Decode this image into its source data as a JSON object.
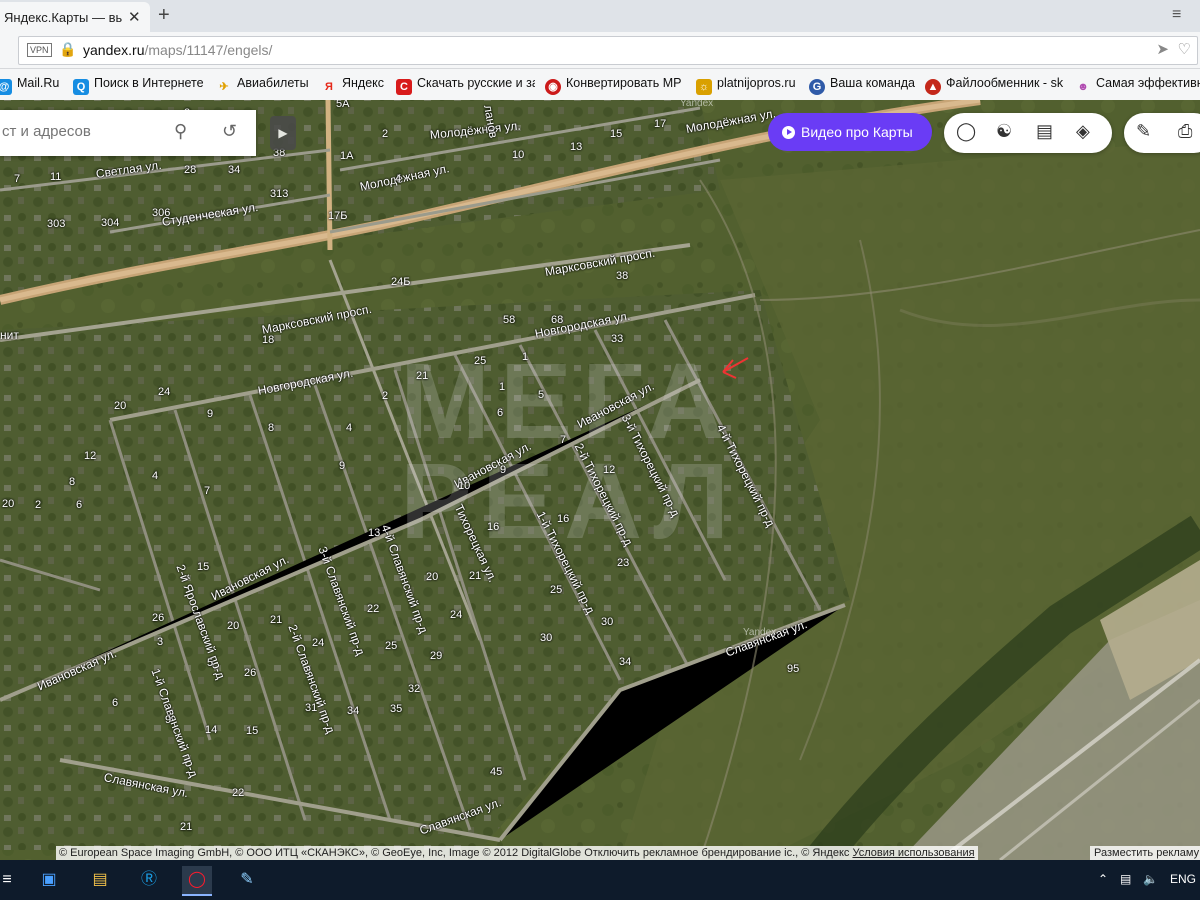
{
  "browser": {
    "tab_title": "Яндекс.Карты — выбирай",
    "close_glyph": "✕",
    "new_tab_glyph": "+",
    "menu_glyph": "≡",
    "vpn_label": "VPN",
    "url_host": "yandex.ru",
    "url_path": "/maps/11147/engels/"
  },
  "bookmarks": [
    {
      "label": "Mail.Ru",
      "icon": "mailru-icon",
      "color": "#168de2"
    },
    {
      "label": "Поиск в Интернете",
      "icon": "search-icon",
      "color": "#168de2"
    },
    {
      "label": "Авиабилеты",
      "icon": "plane-icon",
      "color": "#f2a400"
    },
    {
      "label": "Яндекс",
      "icon": "yandex-icon",
      "color": "#e5281a"
    },
    {
      "label": "Скачать русские и за",
      "icon": "download-icon",
      "color": "#d81b1b"
    },
    {
      "label": "Конвертировать МР",
      "icon": "convert-icon",
      "color": "#cc1a1a"
    },
    {
      "label": "platnijopros.ru",
      "icon": "poll-icon",
      "color": "#d9a000"
    },
    {
      "label": "Ваша команда",
      "icon": "team-icon",
      "color": "#2f5aa8"
    },
    {
      "label": "Файлообменник - sk",
      "icon": "file-share-icon",
      "color": "#c4281a"
    },
    {
      "label": "Самая эффективна",
      "icon": "effective-icon",
      "color": "#b04ab0"
    }
  ],
  "map_ui": {
    "search_placeholder": "ст и адресов",
    "video_button": "Видео про Карты",
    "copyright": "© European Space Imaging GmbH, © ООО ИТЦ «СКАНЭКС», © GeoEye, Inc, Image © 2012 DigitalGlobe",
    "ad_disable": "Отключить рекламное брендирование",
    "copyright_yandex": "ic., © Яндекс",
    "terms": "Условия использования",
    "place_ad": "Разместить рекламу",
    "yandex_mark": "Yandex",
    "watermark_line1": "МЕГА",
    "watermark_line2": "РЕАЛ"
  },
  "streets": [
    {
      "name": "Светлая ул."
    },
    {
      "name": "Студенческая ул."
    },
    {
      "name": "Молодёжная ул."
    },
    {
      "name": "Молодёжная ул."
    },
    {
      "name": "Молодёжная ул."
    },
    {
      "name": "Марксовский просп."
    },
    {
      "name": "Марксовский просп."
    },
    {
      "name": "Новгородская ул."
    },
    {
      "name": "Новгородская ул."
    },
    {
      "name": "Ивановская ул."
    },
    {
      "name": "Ивановская ул."
    },
    {
      "name": "Ивановская ул."
    },
    {
      "name": "Ивановская ул."
    },
    {
      "name": "3-й Тихорецкий пр-д"
    },
    {
      "name": "4-й Тихорецкий пр-д"
    },
    {
      "name": "2-й Тихорецкий пр-д"
    },
    {
      "name": "1-й Тихорецкий пр-д"
    },
    {
      "name": "Тихорецкая ул."
    },
    {
      "name": "4-й Славянский пр-д"
    },
    {
      "name": "3-й Славянский пр-д"
    },
    {
      "name": "2-й Славянский пр-д"
    },
    {
      "name": "2-й Ярославский пр-д"
    },
    {
      "name": "1-й Славянский пр-д"
    },
    {
      "name": "Славянская ул."
    },
    {
      "name": "Славянская ул."
    },
    {
      "name": "Славянская ул."
    },
    {
      "name": "ланов"
    },
    {
      "name": "нит"
    }
  ],
  "house_numbers": [
    "5А",
    "2",
    "1А",
    "38",
    "28",
    "34",
    "11",
    "313",
    "306",
    "304",
    "303",
    "7",
    "15",
    "10",
    "13",
    "17",
    "4",
    "17Б",
    "24Б",
    "38",
    "68",
    "58",
    "18",
    "33",
    "25",
    "1",
    "24",
    "20",
    "21",
    "2",
    "1",
    "9",
    "5",
    "4",
    "9",
    "12",
    "8",
    "6",
    "2",
    "7",
    "4",
    "9",
    "8",
    "10",
    "6",
    "7",
    "12",
    "16",
    "15",
    "21",
    "13",
    "20",
    "25",
    "16",
    "30",
    "23",
    "22",
    "24",
    "20",
    "26",
    "21",
    "24",
    "25",
    "29",
    "34",
    "30",
    "3",
    "5",
    "26",
    "6",
    "9",
    "14",
    "15",
    "32",
    "31",
    "34",
    "35",
    "20",
    "22",
    "21",
    "45",
    "95",
    "2"
  ],
  "taskbar": {
    "lang": "ENG"
  },
  "colors": {
    "yandex_purple": "#6a3cf5",
    "marker_red": "#e33"
  }
}
